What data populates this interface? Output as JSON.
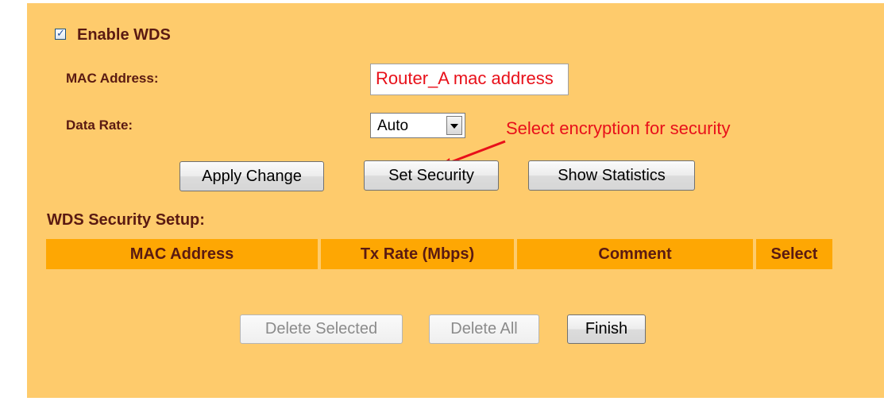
{
  "wds": {
    "enable_label": "Enable WDS",
    "enable_checked": true,
    "mac_label": "MAC Address:",
    "mac_value": "Router_A mac address",
    "rate_label": "Data Rate:",
    "rate_value": "Auto",
    "annotation": "Select encryption for security"
  },
  "buttons": {
    "apply": "Apply Change",
    "security": "Set Security",
    "stats": "Show Statistics",
    "delete_selected": "Delete Selected",
    "delete_all": "Delete All",
    "finish": "Finish"
  },
  "security_table": {
    "title": "WDS Security Setup:",
    "columns": [
      "MAC Address",
      "Tx Rate (Mbps)",
      "Comment",
      "Select"
    ],
    "rows": []
  },
  "icons": {
    "checkbox_tick": "check-icon",
    "dropdown": "chevron-down-icon",
    "annotation_arrow": "arrow-icon"
  },
  "colors": {
    "panel_bg": "#fecb6c",
    "header_bg": "#fea703",
    "label_text": "#5a1a12",
    "annotation": "#e8101a"
  }
}
